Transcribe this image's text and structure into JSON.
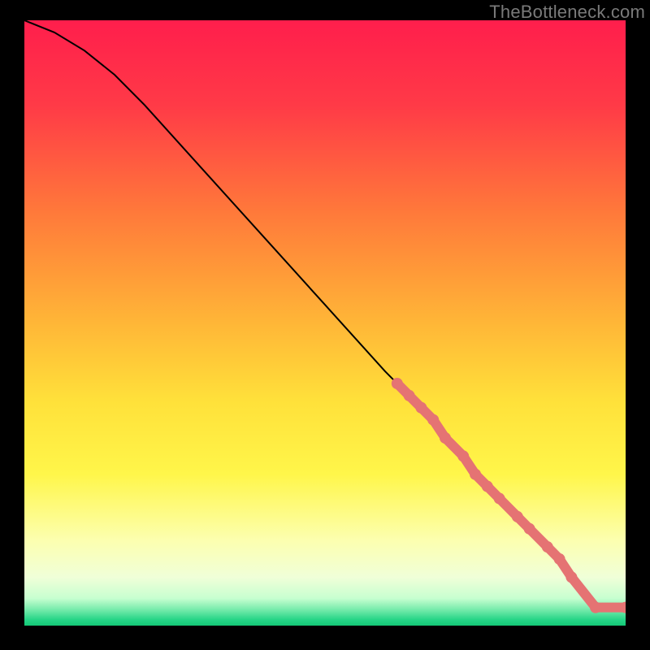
{
  "watermark": {
    "text": "TheBottleneck.com"
  },
  "chart_data": {
    "type": "line",
    "title": "",
    "xlabel": "",
    "ylabel": "",
    "xlim": [
      0,
      100
    ],
    "ylim": [
      0,
      100
    ],
    "gradient_stops": [
      {
        "offset": 0,
        "color": "#ff1e4c"
      },
      {
        "offset": 0.14,
        "color": "#ff3a47"
      },
      {
        "offset": 0.32,
        "color": "#ff7a3a"
      },
      {
        "offset": 0.5,
        "color": "#ffb637"
      },
      {
        "offset": 0.63,
        "color": "#ffe13a"
      },
      {
        "offset": 0.75,
        "color": "#fff64a"
      },
      {
        "offset": 0.86,
        "color": "#fcffb0"
      },
      {
        "offset": 0.92,
        "color": "#f0ffd8"
      },
      {
        "offset": 0.955,
        "color": "#c7ffd0"
      },
      {
        "offset": 0.975,
        "color": "#6fe9a8"
      },
      {
        "offset": 0.99,
        "color": "#26d587"
      },
      {
        "offset": 1.0,
        "color": "#14c877"
      }
    ],
    "series": [
      {
        "name": "bottleneck-curve",
        "x": [
          0,
          5,
          10,
          15,
          20,
          30,
          40,
          50,
          60,
          65,
          70,
          75,
          80,
          83,
          86,
          89,
          91,
          93,
          95,
          100
        ],
        "y": [
          100,
          98,
          95,
          91,
          86,
          75,
          64,
          53,
          42,
          37,
          31,
          25,
          20,
          17,
          14,
          11,
          8,
          6,
          3,
          3
        ]
      }
    ],
    "highlighted_points": {
      "name": "highlighted-dots",
      "color": "#e57373",
      "x": [
        62,
        64,
        66,
        68,
        70,
        73,
        75,
        77,
        79,
        82,
        84,
        87,
        89,
        91,
        95,
        100
      ],
      "y": [
        40,
        38,
        36,
        34,
        31,
        28,
        25,
        23,
        21,
        18,
        16,
        13,
        11,
        8,
        3,
        3
      ]
    }
  }
}
